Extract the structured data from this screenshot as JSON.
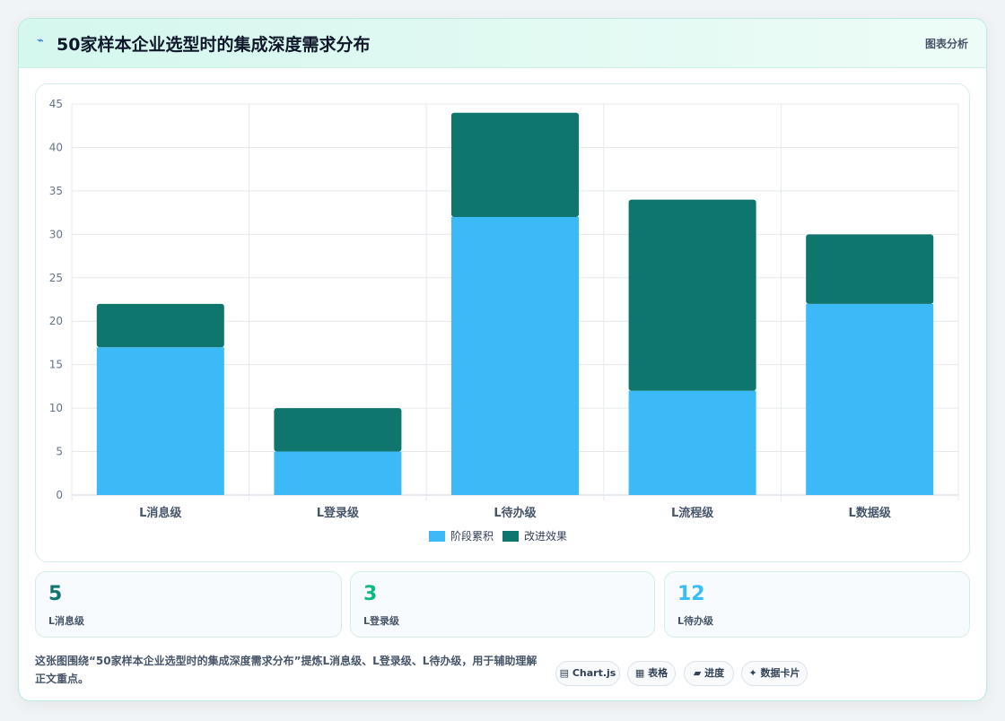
{
  "header": {
    "icon": "lightning-icon",
    "title": "50家样本企业选型时的集成深度需求分布",
    "link_label": "图表分析"
  },
  "colors": {
    "series_1": "#3bbaf7",
    "series_2": "#0f766e",
    "stat_1": "#0f766e",
    "stat_2": "#10b981",
    "stat_3": "#38bdf8"
  },
  "chart_data": {
    "type": "bar",
    "stacked": true,
    "categories": [
      "L消息级",
      "L登录级",
      "L待办级",
      "L流程级",
      "L数据级"
    ],
    "series": [
      {
        "name": "阶段累积",
        "values": [
          17,
          5,
          32,
          12,
          22
        ],
        "color": "#3bbaf7"
      },
      {
        "name": "改进效果",
        "values": [
          5,
          5,
          12,
          22,
          8
        ],
        "color": "#0f766e"
      }
    ],
    "ylim": [
      0,
      45
    ],
    "yticks": [
      0,
      5,
      10,
      15,
      20,
      25,
      30,
      35,
      40,
      45
    ],
    "grid": true,
    "legend": "bottom"
  },
  "stats": [
    {
      "value": "5",
      "label": "L消息级"
    },
    {
      "value": "3",
      "label": "L登录级"
    },
    {
      "value": "12",
      "label": "L待办级"
    }
  ],
  "footer": {
    "description": "这张图围绕“50家样本企业选型时的集成深度需求分布”提炼L消息级、L登录级、L待办级，用于辅助理解正文重点。",
    "tags": [
      {
        "icon": "chart-icon",
        "label": "▤ Chart.js"
      },
      {
        "icon": "table-icon",
        "label": "▦ 表格"
      },
      {
        "icon": "progress-icon",
        "label": "▰ 进度"
      },
      {
        "icon": "card-icon",
        "label": "✦ 数据卡片"
      }
    ]
  }
}
